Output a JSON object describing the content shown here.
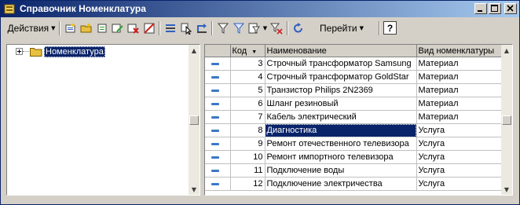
{
  "window": {
    "title": "Справочник Номенклатура"
  },
  "toolbar": {
    "actions_label": "Действия",
    "goto_label": "Перейти",
    "help_label": "?"
  },
  "tree": {
    "root_label": "Номенклатура"
  },
  "table": {
    "columns": [
      "Код",
      "Наименование",
      "Вид номенклатуры"
    ],
    "rows": [
      {
        "code": "3",
        "name": "Строчный трансформатор Samsung",
        "kind": "Материал"
      },
      {
        "code": "4",
        "name": "Строчный трансформатор GoldStar",
        "kind": "Материал"
      },
      {
        "code": "5",
        "name": "Транзистор Philips 2N2369",
        "kind": "Материал"
      },
      {
        "code": "6",
        "name": "Шланг резиновый",
        "kind": "Материал"
      },
      {
        "code": "7",
        "name": "Кабель электрический",
        "kind": "Материал"
      },
      {
        "code": "8",
        "name": "Диагностика",
        "kind": "Услуга"
      },
      {
        "code": "9",
        "name": "Ремонт отечественного телевизора",
        "kind": "Услуга"
      },
      {
        "code": "10",
        "name": "Ремонт импортного телевизора",
        "kind": "Услуга"
      },
      {
        "code": "11",
        "name": "Подключение воды",
        "kind": "Услуга"
      },
      {
        "code": "12",
        "name": "Подключение электричества",
        "kind": "Услуга"
      }
    ],
    "selected_row": 5
  },
  "colors": {
    "title_start": "#0a246a",
    "title_end": "#a6caf0",
    "selection": "#0a246a",
    "folder": "#e8c040"
  }
}
